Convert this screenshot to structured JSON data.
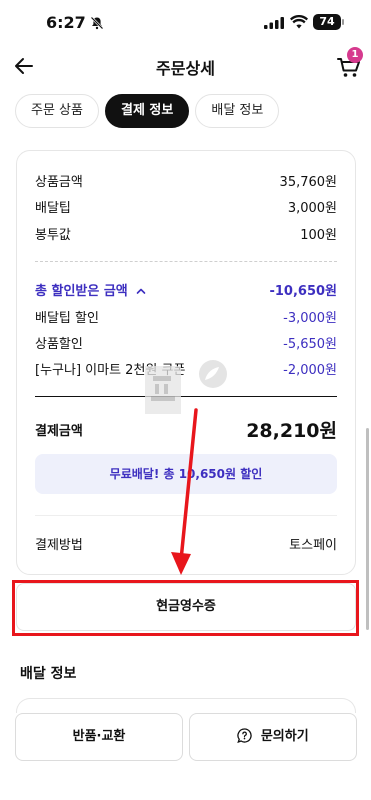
{
  "status_bar": {
    "time": "6:27",
    "battery": "74"
  },
  "header": {
    "title": "주문상세",
    "cart_count": "1"
  },
  "tabs": [
    {
      "label": "주문 상품"
    },
    {
      "label": "결제 정보"
    },
    {
      "label": "배달 정보"
    }
  ],
  "payment": {
    "rows": [
      {
        "label": "상품금액",
        "value": "35,760원"
      },
      {
        "label": "배달팁",
        "value": "3,000원"
      },
      {
        "label": "봉투값",
        "value": "100원"
      }
    ],
    "discount_total": {
      "label": "총 할인받은 금액",
      "value": "-10,650원"
    },
    "discounts": [
      {
        "label": "배달팁 할인",
        "value": "-3,000원"
      },
      {
        "label": "상품할인",
        "value": "-5,650원"
      },
      {
        "label": "[누구나] 이마트 2천원 쿠폰",
        "value": "-2,000원"
      }
    ],
    "total": {
      "label": "결제금액",
      "value": "28,210원"
    },
    "free_delivery_banner": "무료배달! 총 10,650원 할인",
    "method": {
      "label": "결제방법",
      "value": "토스페이"
    }
  },
  "receipt_button": "현금영수증",
  "delivery_section_title": "배달 정보",
  "bottom_buttons": {
    "return_exchange": "반품·교환",
    "inquiry": "문의하기"
  },
  "colors": {
    "accent_purple": "#3d2fc0",
    "annotation_red": "#e8161c",
    "badge_pink": "#d63a8e"
  }
}
